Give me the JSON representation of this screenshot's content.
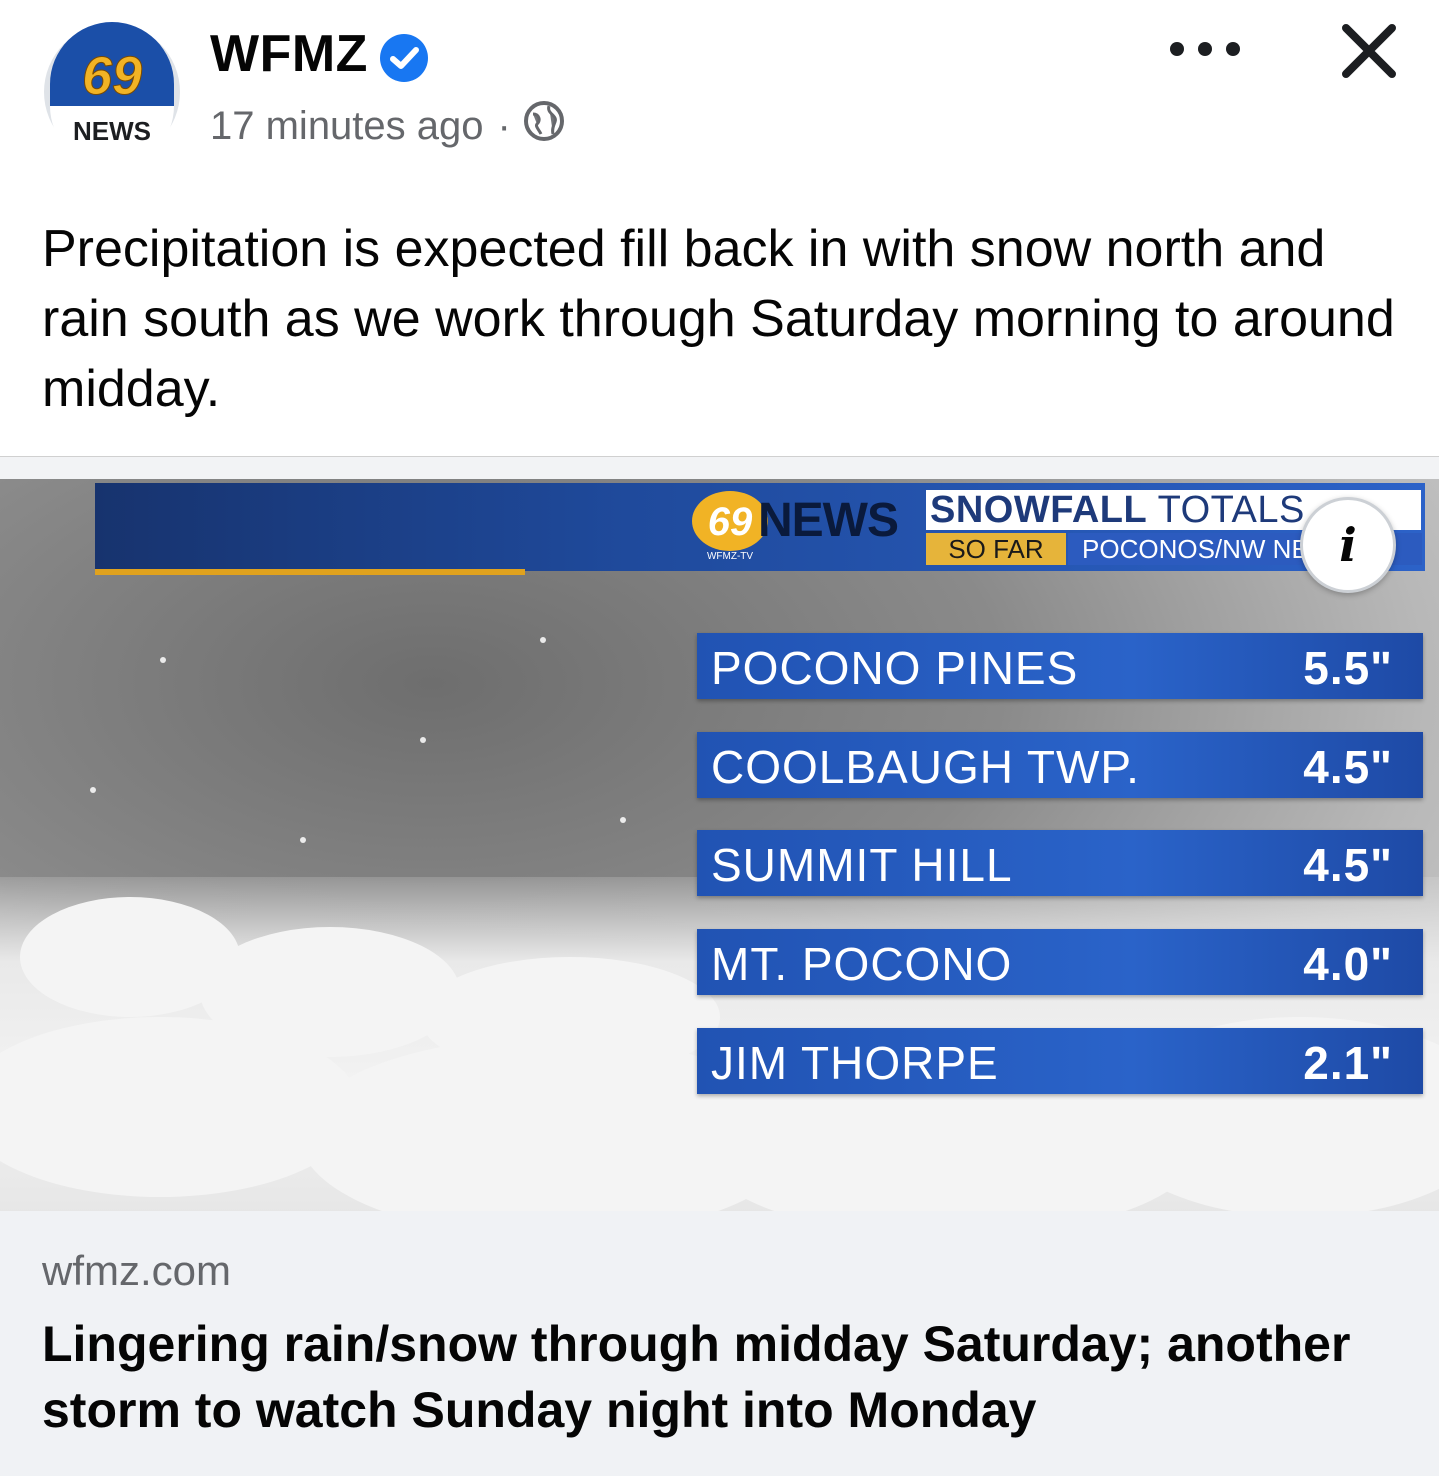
{
  "post": {
    "page_name": "WFMZ",
    "verified_icon": "verified-badge-icon",
    "timestamp": "17 minutes ago",
    "separator": "·",
    "audience_icon": "globe-icon",
    "avatar": {
      "number": "69",
      "label": "NEWS"
    },
    "text": "Precipitation is expected fill back in with snow north and rain south as we work through Saturday morning to around midday."
  },
  "image": {
    "banner": {
      "logo_number": "69",
      "logo_small": "WFMZ-TV",
      "news": "NEWS",
      "title_bold": "SNOWFALL",
      "title_thin": "TOTALS",
      "sub_left": "SO FAR",
      "sub_right": "POCONOS/NW NEW"
    },
    "info_label": "i",
    "rows": [
      {
        "location": "POCONO PINES",
        "amount": "5.5\""
      },
      {
        "location": "COOLBAUGH TWP.",
        "amount": "4.5\""
      },
      {
        "location": "SUMMIT HILL",
        "amount": "4.5\""
      },
      {
        "location": "MT. POCONO",
        "amount": "4.0\""
      },
      {
        "location": "JIM THORPE",
        "amount": "2.1\""
      }
    ]
  },
  "link": {
    "domain": "wfmz.com",
    "headline": "Lingering rain/snow through midday Saturday; another storm to watch Sunday night into Monday"
  },
  "colors": {
    "brand_blue": "#1877f2",
    "secondary_text": "#65676b",
    "preview_bg": "#f0f2f5",
    "banner_blue": "#2153b3",
    "banner_gold": "#e6b43a"
  }
}
